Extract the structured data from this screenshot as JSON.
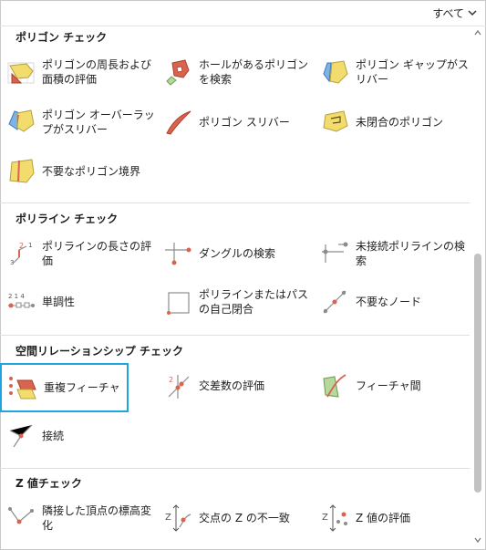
{
  "filter": {
    "label": "すべて"
  },
  "sections": [
    {
      "title": "ポリゴン チェック",
      "items": [
        "ポリゴンの周長および面積の評価",
        "ホールがあるポリゴンを検索",
        "ポリゴン ギャップがスリバー",
        "ポリゴン オーバーラップがスリバー",
        "ポリゴン スリバー",
        "未閉合のポリゴン",
        "不要なポリゴン境界"
      ]
    },
    {
      "title": "ポリライン チェック",
      "items": [
        "ポリラインの長さの評価",
        "ダングルの検索",
        "未接続ポリラインの検索",
        "単調性",
        "ポリラインまたはパスの自己閉合",
        "不要なノード"
      ]
    },
    {
      "title": "空間リレーションシップ チェック",
      "items": [
        "重複フィーチャ",
        "交差数の評価",
        "フィーチャ間",
        "接続"
      ]
    },
    {
      "title": "Z 値チェック",
      "items": [
        "隣接した頂点の標高変化",
        "交点の Z の不一致",
        "Z 値の評価"
      ]
    }
  ],
  "icon_colors": {
    "yellow": "#f2dc6e",
    "red": "#d9634c",
    "blue": "#7db3e8",
    "green": "#b5d99c",
    "gray": "#8c8c8c"
  },
  "selected_color": "#1ea5e0"
}
